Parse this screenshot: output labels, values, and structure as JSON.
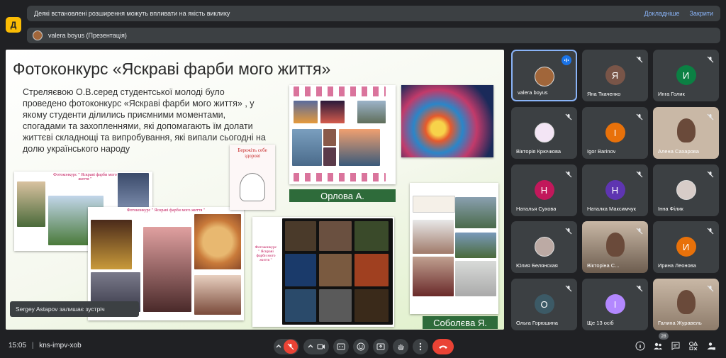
{
  "notice": {
    "message": "Деякі встановлені розширення можуть впливати на якість виклику",
    "details_link": "Докладніше",
    "close_link": "Закрити"
  },
  "app": {
    "logo_glyph": "Д"
  },
  "presenter": {
    "label": "valera boyus (Презентація)"
  },
  "slide": {
    "title": "Фотоконкурс «Яскраві фарби мого життя»",
    "body": "Стреляєвою О.В.серед студентської молоді було проведено фотоконкурс «Яскраві фарби мого життя» , у якому студенти ділились приємними моментами,  спогадами та захопленнями, які допомагають їм долати життєві складнощі та випробування, які випали сьогодні на долю українського народу",
    "label_orlova": "Орлова А.",
    "label_sobolieva": "Соболєва Я.",
    "card1_caption": "Фотоконкурс \" Яскраві фарби мого життя \"",
    "card2_caption": "Фотоконкурс \" Яскраві фарби мого життя \"",
    "card3_caption": "Фотоконкурс \" Яскраві фарби мого життя \"",
    "sign_text": "Бережіть себе здорові"
  },
  "toast": {
    "text": "Sergey Astapov залишає зустріч"
  },
  "participants": [
    {
      "name": "valera boyus",
      "initial": "",
      "color": "#a1663a",
      "active": true
    },
    {
      "name": "Яна Ткаченко",
      "initial": "Я",
      "color": "#795548"
    },
    {
      "name": "Инга Голик",
      "initial": "И",
      "color": "#0b8043"
    },
    {
      "name": "Вікторія Крючкова",
      "initial": "",
      "color": "#f3e5f5"
    },
    {
      "name": "Igor Barinov",
      "initial": "I",
      "color": "#e8710a"
    },
    {
      "name": "Алена Сахарова",
      "initial": "",
      "color": "#c9b8a6"
    },
    {
      "name": "Наталья Сухова",
      "initial": "Н",
      "color": "#c2185b"
    },
    {
      "name": "Наталка Максимчук",
      "initial": "Н",
      "color": "#5e35b1"
    },
    {
      "name": "Інна Філик",
      "initial": "",
      "color": "#d7ccc8"
    },
    {
      "name": "Юлия Белянская",
      "initial": "",
      "color": "#bcaaa4"
    },
    {
      "name": "Вікторіна С...",
      "initial": "",
      "color": "#6d5d4f"
    },
    {
      "name": "Ирина Леонова",
      "initial": "И",
      "color": "#e8710a"
    },
    {
      "name": "Ольга Горюшина",
      "initial": "О",
      "color": "#3c5a66"
    },
    {
      "name": "Ще 13 осіб",
      "initial": "I",
      "color": "#b388ff"
    },
    {
      "name": "Галина Журавель",
      "initial": "",
      "color": "#8d7b6a"
    }
  ],
  "bottom": {
    "time": "15:05",
    "separator": "|",
    "meeting_code": "kns-impv-xob",
    "participant_count": "28"
  }
}
